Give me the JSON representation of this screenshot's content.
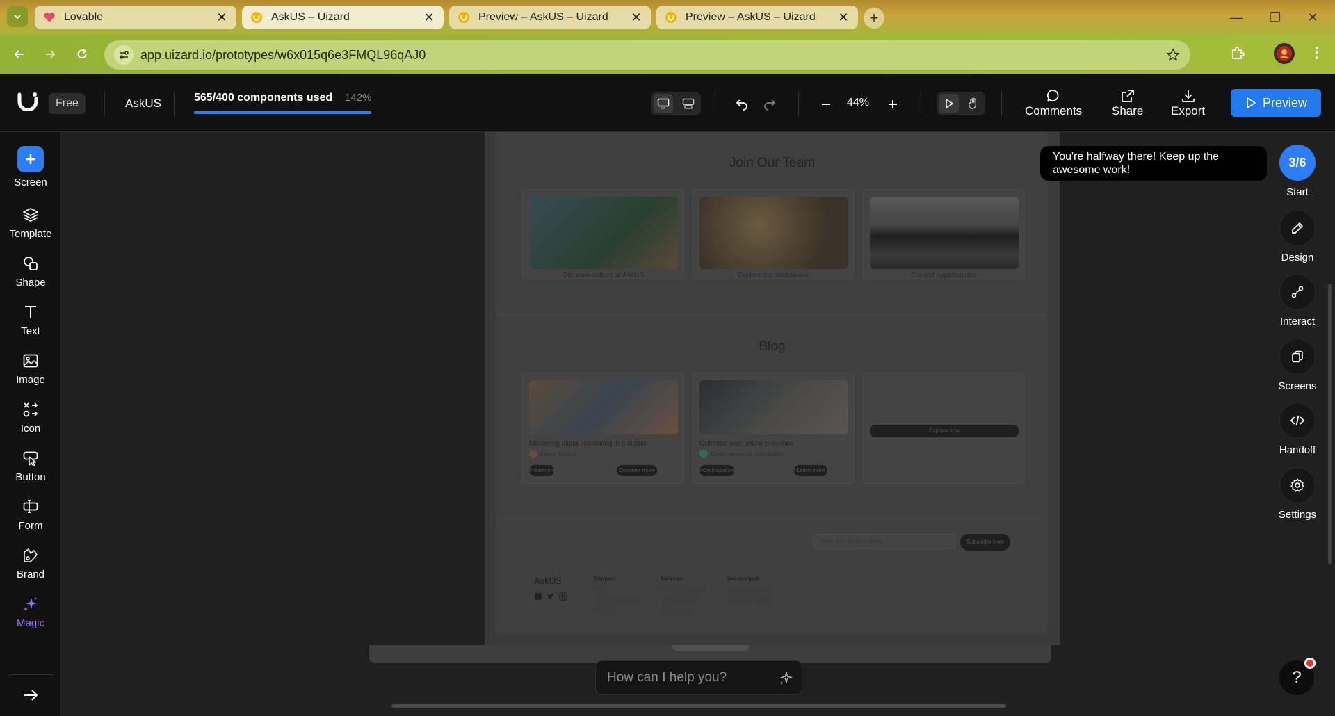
{
  "browser": {
    "tabs": [
      {
        "title": "Lovable",
        "active": false
      },
      {
        "title": "AskUS – Uizard",
        "active": true
      },
      {
        "title": "Preview – AskUS – Uizard",
        "active": false
      },
      {
        "title": "Preview – AskUS – Uizard",
        "active": false
      }
    ],
    "url": "app.uizard.io/prototypes/w6x015q6e3FMQL96qAJ0"
  },
  "appbar": {
    "plan": "Free",
    "project": "AskUS",
    "usage_text": "565/400 components used",
    "usage_percent": "142%",
    "usage_fraction": 1.0,
    "zoom": "44%",
    "actions": {
      "comments": "Comments",
      "share": "Share",
      "export": "Export"
    },
    "preview": "Preview"
  },
  "leftbar": {
    "screen": "Screen",
    "template": "Template",
    "shape": "Shape",
    "text": "Text",
    "image": "Image",
    "icon": "Icon",
    "button": "Button",
    "form": "Form",
    "brand": "Brand",
    "magic": "Magic"
  },
  "screen_content": {
    "join_title": "Join Our Team",
    "join_cards": [
      "Our work culture at AskUS",
      "Explore our workspace",
      "Current opportunities"
    ],
    "blog_title": "Blog",
    "blog_posts": [
      {
        "title": "Mastering digital marketing in 5 simple",
        "author": "Expert insights",
        "tag": "#Marketing",
        "cta": "Discover more"
      },
      {
        "title": "Optimize your online presence",
        "author": "Expert advice on optimization",
        "tag": "#Optimization",
        "cta": "Learn more"
      }
    ],
    "explore_cta": "Explore now",
    "email_placeholder": "Enter your email address",
    "subscribe": "Subscribe Now",
    "footer": {
      "brand": "AskUS",
      "support": {
        "heading": "Support",
        "links": [
          "FAQs",
          "Customer Support",
          "Help Tips"
        ]
      },
      "services": {
        "heading": "Services",
        "links": [
          "Privacy Guidelines",
          "Site Navigation",
          "Subscriptions"
        ]
      },
      "contact": {
        "heading": "Get in touch",
        "links": [
          "contact@ask.com",
          "+123 456 789 000"
        ]
      }
    }
  },
  "toast": "You're halfway there! Keep up the awesome work!",
  "rightbar": {
    "progress": "3/6",
    "start": "Start",
    "design": "Design",
    "interact": "Interact",
    "screens": "Screens",
    "handoff": "Handoff",
    "settings": "Settings"
  },
  "chat": {
    "placeholder": "How can I help you?"
  },
  "help": "?",
  "colors": {
    "accent": "#2f7df6",
    "magic": "#9b6cf7",
    "notification": "#e5322d"
  }
}
